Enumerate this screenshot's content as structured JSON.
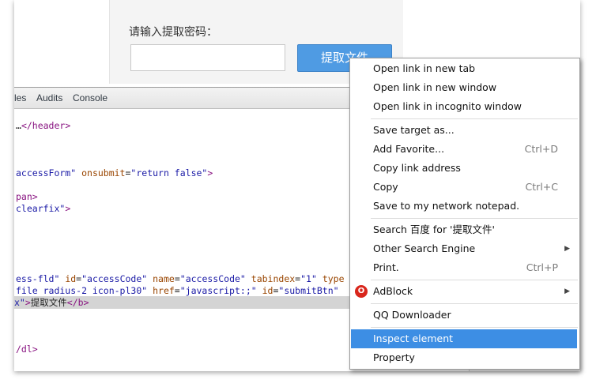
{
  "page": {
    "form_label": "请输入提取密码：",
    "password_value": "",
    "submit_label": "提取文件"
  },
  "devtools": {
    "tabs": [
      "les",
      "Audits",
      "Console"
    ],
    "code_lines": [
      {
        "parts": [
          {
            "t": "…",
            "c": "txt"
          },
          {
            "t": "</header>",
            "c": "tag"
          }
        ]
      },
      {
        "parts": [
          {
            "t": "accessForm\"",
            "c": "val"
          },
          {
            "t": " onsubmit",
            "c": "attr"
          },
          {
            "t": "=",
            "c": "txt"
          },
          {
            "t": "\"return false\"",
            "c": "val"
          },
          {
            "t": ">",
            "c": "tag"
          }
        ]
      },
      {
        "parts": [
          {
            "t": "pan>",
            "c": "tag"
          }
        ]
      },
      {
        "parts": [
          {
            "t": "clearfix\"",
            "c": "val"
          },
          {
            "t": ">",
            "c": "tag"
          }
        ]
      },
      {
        "parts": [
          {
            "t": "ess-fld\"",
            "c": "val"
          },
          {
            "t": " id",
            "c": "attr"
          },
          {
            "t": "=",
            "c": "txt"
          },
          {
            "t": "\"accessCode\"",
            "c": "val"
          },
          {
            "t": " name",
            "c": "attr"
          },
          {
            "t": "=",
            "c": "txt"
          },
          {
            "t": "\"accessCode\"",
            "c": "val"
          },
          {
            "t": " tabindex",
            "c": "attr"
          },
          {
            "t": "=",
            "c": "txt"
          },
          {
            "t": "\"1\"",
            "c": "val"
          },
          {
            "t": " type",
            "c": "attr"
          }
        ]
      },
      {
        "parts": [
          {
            "t": "file radius-2 icon-pl30\"",
            "c": "val"
          },
          {
            "t": " href",
            "c": "attr"
          },
          {
            "t": "=",
            "c": "txt"
          },
          {
            "t": "\"javascript:;\"",
            "c": "val"
          },
          {
            "t": " id",
            "c": "attr"
          },
          {
            "t": "=",
            "c": "txt"
          },
          {
            "t": "\"submitBtn\"",
            "c": "val"
          }
        ]
      },
      {
        "parts": [
          {
            "t": "x\"",
            "c": "val"
          },
          {
            "t": ">",
            "c": "tag"
          },
          {
            "t": "提取文件",
            "c": "txt"
          },
          {
            "t": "</b>",
            "c": "tag"
          }
        ],
        "selected": true
      },
      {
        "parts": [
          {
            "t": "/dl>",
            "c": "tag"
          }
        ]
      }
    ]
  },
  "context_menu": {
    "items": [
      {
        "label": "Open link in new tab",
        "shortcut": "",
        "name": "menu-open-new-tab"
      },
      {
        "label": "Open link in new window",
        "shortcut": "",
        "name": "menu-open-new-window"
      },
      {
        "label": "Open link in incognito window",
        "shortcut": "",
        "name": "menu-open-incognito"
      },
      {
        "label": "Save target as...",
        "shortcut": "",
        "name": "menu-save-target"
      },
      {
        "label": "Add Favorite...",
        "shortcut": "Ctrl+D",
        "name": "menu-add-favorite"
      },
      {
        "label": "Copy link address",
        "shortcut": "",
        "name": "menu-copy-link"
      },
      {
        "label": "Copy",
        "shortcut": "Ctrl+C",
        "name": "menu-copy"
      },
      {
        "label": "Save to my network notepad.",
        "shortcut": "",
        "name": "menu-save-notepad"
      },
      {
        "label": "Search 百度 for '提取文件'",
        "shortcut": "",
        "name": "menu-search-baidu"
      },
      {
        "label": "Other Search Engine",
        "shortcut": "",
        "name": "menu-other-search"
      },
      {
        "label": "Print.",
        "shortcut": "Ctrl+P",
        "name": "menu-print"
      },
      {
        "label": "AdBlock",
        "shortcut": "",
        "name": "menu-adblock"
      },
      {
        "label": "QQ Downloader",
        "shortcut": "",
        "name": "menu-qq-downloader"
      },
      {
        "label": "Inspect element",
        "shortcut": "",
        "name": "menu-inspect-element"
      },
      {
        "label": "Property",
        "shortcut": "",
        "name": "menu-property"
      }
    ],
    "highlighted": "Inspect element",
    "adblock_icon_glyph": "O",
    "highlight_color": "#3d8ee4"
  }
}
